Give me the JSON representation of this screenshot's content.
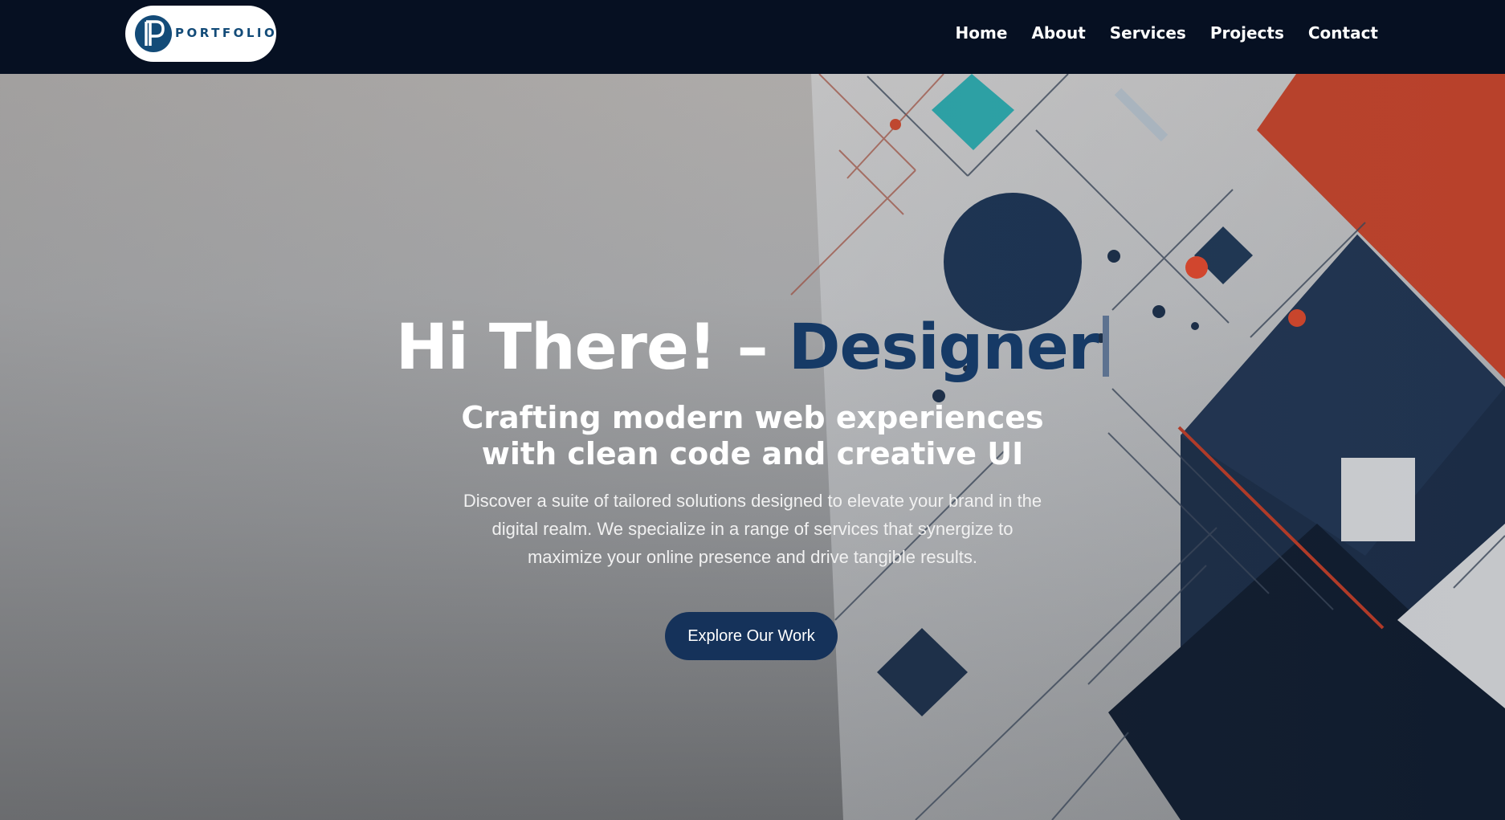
{
  "brand": {
    "logo_letter": "P",
    "logo_text": "PORTFOLIO"
  },
  "nav": {
    "items": [
      {
        "label": "Home"
      },
      {
        "label": "About"
      },
      {
        "label": "Services"
      },
      {
        "label": "Projects"
      },
      {
        "label": "Contact"
      }
    ]
  },
  "hero": {
    "title_prefix": "Hi There! – ",
    "title_accent": "Designer",
    "subtitle": "Crafting modern web experiences with clean code and creative UI",
    "description": "Discover a suite of tailored solutions designed to elevate your brand in the digital realm. We specialize in a range of services that synergize to maximize your online presence and drive tangible results.",
    "cta_label": "Explore Our Work"
  },
  "colors": {
    "navbar_bg": "#061022",
    "accent_navy": "#163a66",
    "button_bg": "#15325a",
    "art_orange": "#c8442a",
    "art_teal": "#2aa3a8"
  },
  "icons": {
    "logo": "p-monogram-icon"
  }
}
